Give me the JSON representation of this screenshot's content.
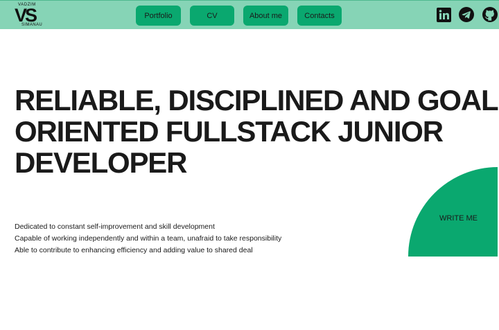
{
  "logo": {
    "monogram": "VS",
    "top_text": "VADZIM",
    "bottom_text": "SIMANAU"
  },
  "nav": {
    "items": [
      {
        "label": "Portfolio"
      },
      {
        "label": "CV"
      },
      {
        "label": "About me"
      },
      {
        "label": "Contacts"
      }
    ]
  },
  "social": {
    "icons": [
      "linkedin-icon",
      "telegram-icon",
      "github-icon"
    ]
  },
  "hero": {
    "title_lines": [
      "RELIABLE, DISCIPLINED AND GOAL-",
      "ORIENTED FULLSTACK JUNIOR",
      "DEVELOPER"
    ],
    "bullets": [
      "Dedicated to constant self-improvement and skill development",
      "Capable of working independently and within a team, unafraid to take responsibility",
      "Able to contribute to enhancing efficiency and adding value to shared deal"
    ]
  },
  "cta": {
    "label": "WRITE ME"
  },
  "colors": {
    "header_bg": "#86d4b6",
    "accent": "#0aa86f",
    "text": "#1a1a1a",
    "page_bg": "#ffffff"
  }
}
